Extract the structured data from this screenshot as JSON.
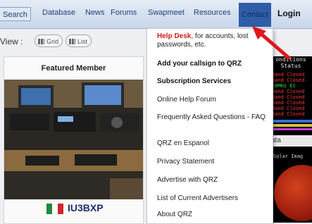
{
  "nav": {
    "search": "Search",
    "database": "Database",
    "news": "News",
    "forums": "Forums",
    "swapmeet": "Swapmeet",
    "resources": "Resources",
    "contact": "Contact",
    "login": "Login"
  },
  "view": {
    "label": "View :",
    "grid": "Grid",
    "list": "List"
  },
  "featured": {
    "title": "Featured Member",
    "callsign": "IU3BXP"
  },
  "contact_menu": {
    "help_desk_title": "Help Desk",
    "help_desk_text": ", for accounts, lost passwords, etc.",
    "items": [
      "Add your callsign to QRZ",
      "Subscription Services",
      "Online Help Forum",
      "Frequently Asked Questions - FAQ",
      "QRZ en Espanol",
      "Privacy Statement",
      "Advertise with QRZ",
      "List of Current Advertisers",
      "About QRZ"
    ]
  },
  "side_panel": {
    "header_line1": "onditions",
    "header_line2": "Status",
    "lines": [
      "Band Closed",
      "Band Closed",
      "50MHz ES",
      "Band Closed",
      "Band Closed",
      "Band Closed",
      "Band Closed",
      "Band Closed"
    ],
    "data_label": "ata",
    "solar_label": "Solar Imag"
  },
  "colors": {
    "accent_red": "#d21a1a",
    "nav_text": "#1d3f7a",
    "contact_bg": "#2f5da6"
  }
}
